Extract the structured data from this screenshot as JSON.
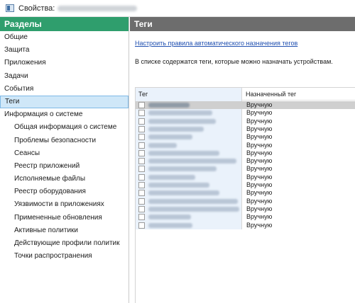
{
  "window": {
    "title": "Свойства:"
  },
  "left_panel": {
    "header": "Разделы",
    "items": [
      {
        "label": "Общие",
        "level": 0
      },
      {
        "label": "Защита",
        "level": 0
      },
      {
        "label": "Приложения",
        "level": 0
      },
      {
        "label": "Задачи",
        "level": 0
      },
      {
        "label": "События",
        "level": 0
      },
      {
        "label": "Теги",
        "level": 0,
        "active": true
      },
      {
        "label": "Информация о системе",
        "level": 0
      },
      {
        "label": "Общая информация о системе",
        "level": 1
      },
      {
        "label": "Проблемы безопасности",
        "level": 1
      },
      {
        "label": "Сеансы",
        "level": 1
      },
      {
        "label": "Реестр приложений",
        "level": 1
      },
      {
        "label": "Исполняемые файлы",
        "level": 1
      },
      {
        "label": "Реестр оборудования",
        "level": 1
      },
      {
        "label": "Уязвимости в приложениях",
        "level": 1
      },
      {
        "label": "Примененные обновления",
        "level": 1
      },
      {
        "label": "Активные политики",
        "level": 1
      },
      {
        "label": "Действующие профили политик",
        "level": 1
      },
      {
        "label": "Точки распространения",
        "level": 1
      }
    ]
  },
  "right_panel": {
    "header": "Теги",
    "rules_link": "Настроить правила автоматического назначения тегов",
    "description": "В списке содержатся теги, которые можно назначать устройствам.",
    "table": {
      "columns": [
        "Тег",
        "Назначенный тег"
      ],
      "rows": [
        {
          "assigned": "Вручную",
          "selected": true
        },
        {
          "assigned": "Вручную"
        },
        {
          "assigned": "Вручную"
        },
        {
          "assigned": "Вручную"
        },
        {
          "assigned": "Вручную"
        },
        {
          "assigned": "Вручную"
        },
        {
          "assigned": "Вручную"
        },
        {
          "assigned": "Вручную"
        },
        {
          "assigned": "Вручную"
        },
        {
          "assigned": "Вручную"
        },
        {
          "assigned": "Вручную"
        },
        {
          "assigned": "Вручную"
        },
        {
          "assigned": "Вручную"
        },
        {
          "assigned": "Вручную"
        },
        {
          "assigned": "Вручную"
        },
        {
          "assigned": "Вручную"
        }
      ]
    }
  },
  "colors": {
    "left_header_bg": "#2f9e6d",
    "right_header_bg": "#6d6d6d",
    "active_item_bg": "#cfe7f8",
    "link": "#1f4fb0",
    "selected_row_bg": "#cfcfcf"
  },
  "icons": {
    "window": "app-window-icon",
    "checkbox": "checkbox-icon"
  }
}
